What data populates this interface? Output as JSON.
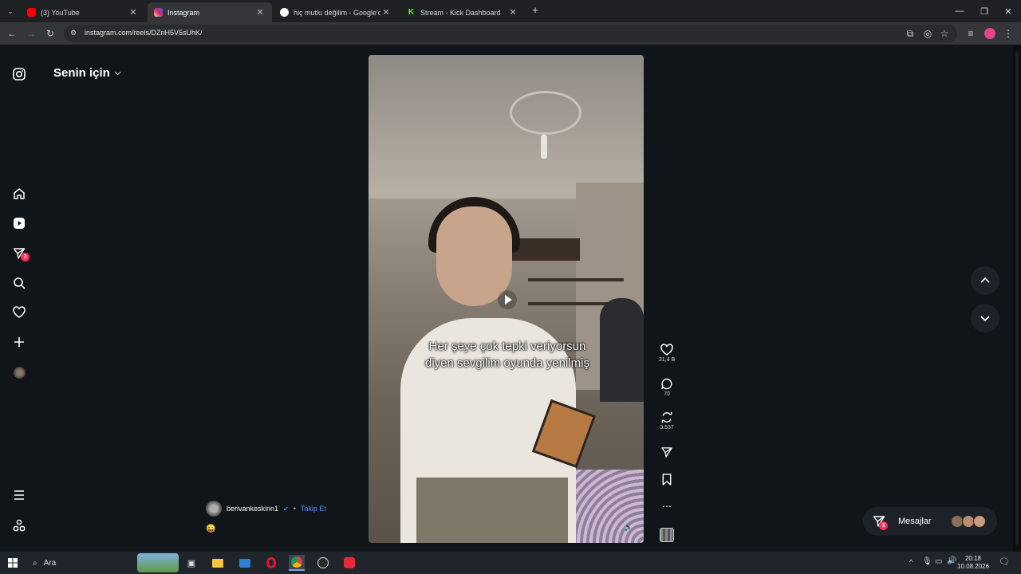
{
  "browser": {
    "tabs": [
      {
        "title": "(3) YouTube",
        "active": false,
        "favicon": "youtube-icon",
        "color": "#ff0000"
      },
      {
        "title": "Instagram",
        "active": true,
        "favicon": "instagram-icon",
        "color": "#d62976"
      },
      {
        "title": "hiç mutlu değilim - Google'da",
        "active": false,
        "favicon": "google-icon",
        "color": "#4285f4"
      },
      {
        "title": "Stream - Kick Dashboard",
        "active": false,
        "favicon": "kick-icon",
        "color": "#53fc18"
      }
    ],
    "url": "instagram.com/reels/DZnH5V5sUhK/"
  },
  "header": {
    "title": "Senin için"
  },
  "leftnav": {
    "messages_badge": "3"
  },
  "reel": {
    "caption": "Her şeye çok tepki veriyorsun diyen sevgilim oyunda yenilmiş",
    "author": "berivankeskinn1",
    "follow_label": "Takip Et",
    "emoji": "😜",
    "likes": "31,4 B",
    "comments": "70",
    "reposts": "3.537"
  },
  "messages": {
    "label": "Mesajlar",
    "badge": "3"
  },
  "taskbar": {
    "search_label": "Ara",
    "time": "20:18",
    "date": "10.08.2026"
  }
}
